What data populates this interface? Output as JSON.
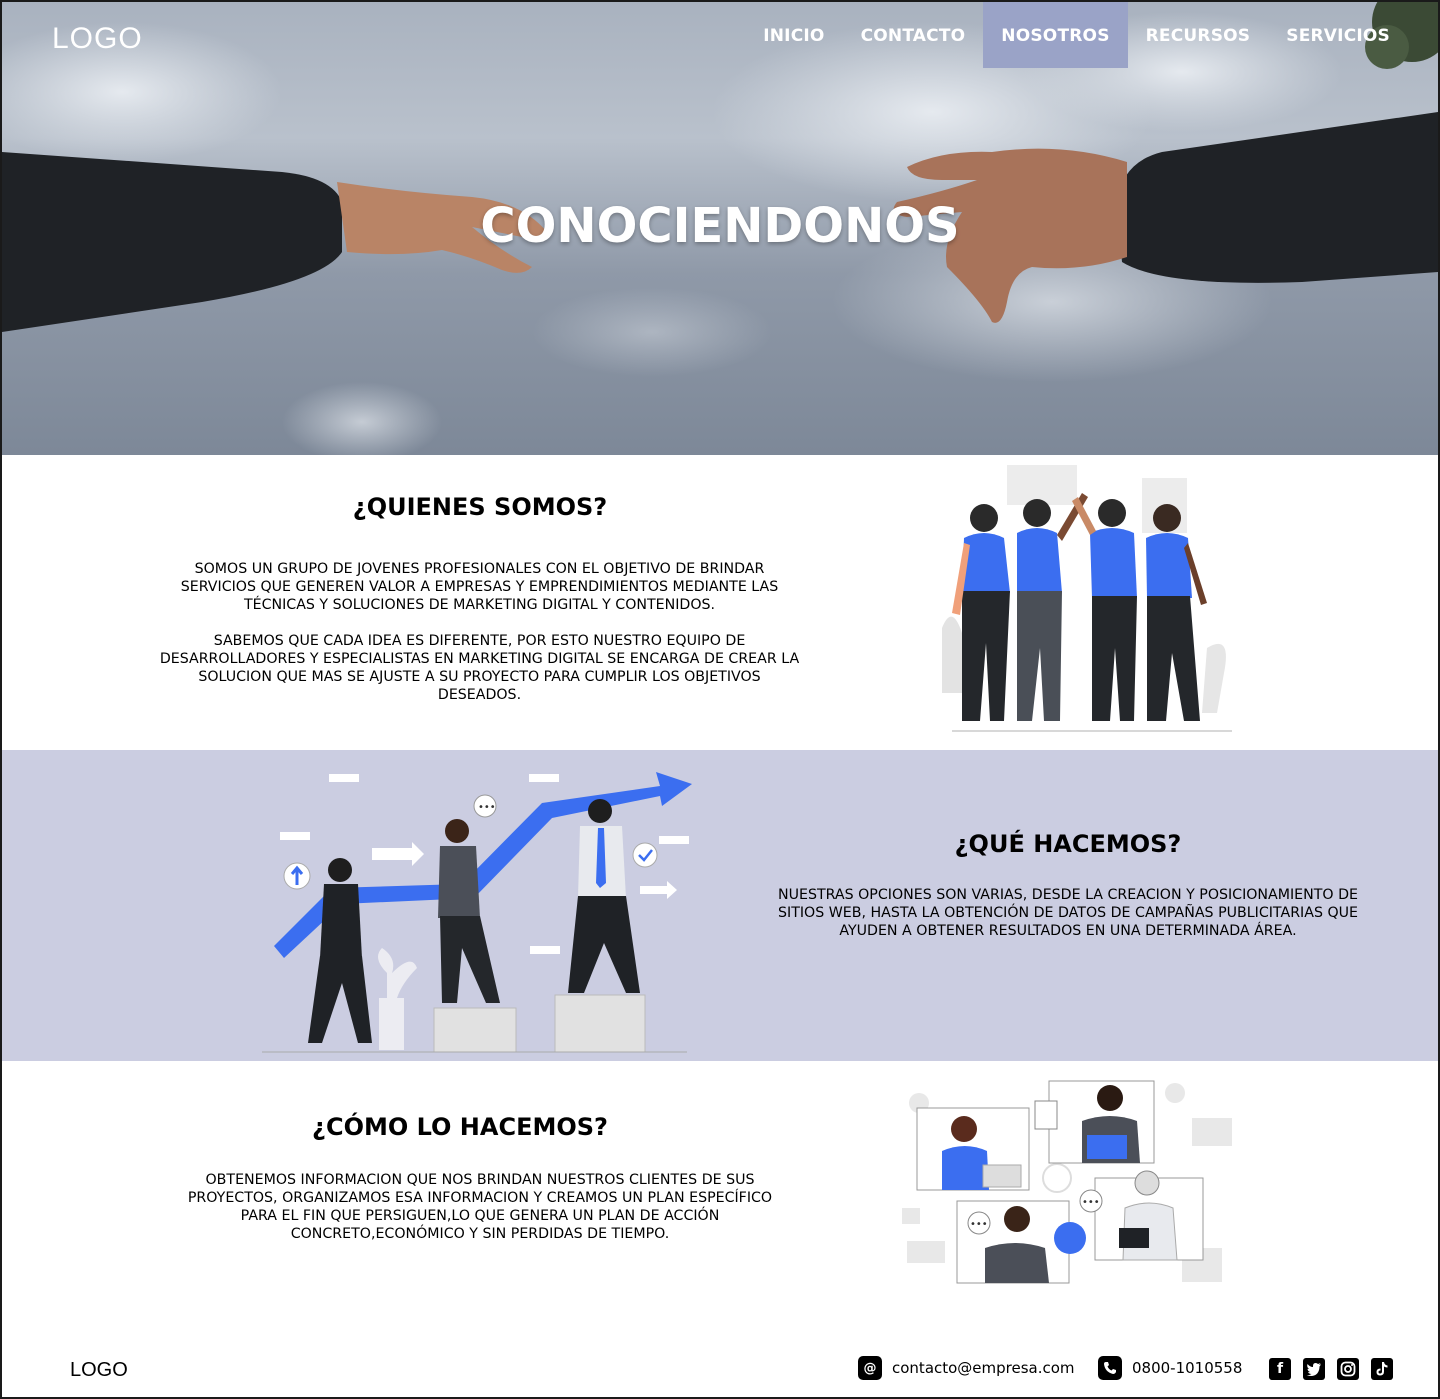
{
  "header": {
    "logo": "LOGO",
    "nav": [
      {
        "label": "INICIO",
        "active": false
      },
      {
        "label": "CONTACTO",
        "active": false
      },
      {
        "label": "NOSOTROS",
        "active": true
      },
      {
        "label": "RECURSOS",
        "active": false
      },
      {
        "label": "SERVICIOS",
        "active": false
      }
    ]
  },
  "hero": {
    "title": "CONOCIENDONOS"
  },
  "quienes": {
    "title": "¿QUIENES SOMOS?",
    "p1": "SOMOS UN GRUPO DE JOVENES PROFESIONALES CON EL OBJETIVO DE BRINDAR SERVICIOS QUE GENEREN VALOR A EMPRESAS Y EMPRENDIMIENTOS MEDIANTE LAS TÉCNICAS Y SOLUCIONES DE MARKETING DIGITAL Y CONTENIDOS.",
    "p2": "SABEMOS QUE CADA IDEA ES DIFERENTE, POR ESTO NUESTRO EQUIPO DE DESARROLLADORES Y ESPECIALISTAS EN MARKETING DIGITAL SE ENCARGA DE CREAR LA SOLUCION QUE MAS SE AJUSTE A SU PROYECTO PARA CUMPLIR LOS OBJETIVOS DESEADOS."
  },
  "que": {
    "title": "¿QUÉ HACEMOS?",
    "p1": "NUESTRAS OPCIONES SON VARIAS, DESDE LA CREACION Y POSICIONAMIENTO DE SITIOS WEB, HASTA LA OBTENCIÓN DE DATOS DE CAMPAÑAS PUBLICITARIAS QUE AYUDEN A OBTENER RESULTADOS EN UNA DETERMINADA ÁREA."
  },
  "como": {
    "title": "¿CÓMO LO HACEMOS?",
    "p1": "OBTENEMOS INFORMACION QUE NOS BRINDAN NUESTROS CLIENTES DE SUS PROYECTOS, ORGANIZAMOS ESA INFORMACION Y CREAMOS UN PLAN ESPECÍFICO PARA EL FIN QUE PERSIGUEN,LO QUE GENERA UN PLAN DE ACCIÓN CONCRETO,ECONÓMICO Y SIN PERDIDAS DE TIEMPO."
  },
  "footer": {
    "logo": "LOGO",
    "email": "contacto@empresa.com",
    "phone": "0800-1010558",
    "email_icon": "at-icon",
    "phone_icon": "phone-icon",
    "socials": [
      "facebook-icon",
      "twitter-icon",
      "instagram-icon",
      "tiktok-icon"
    ]
  },
  "colors": {
    "accent_blue": "#3b6ef0",
    "section_band": "#cbcde1",
    "nav_active": "#9aa3c7"
  }
}
